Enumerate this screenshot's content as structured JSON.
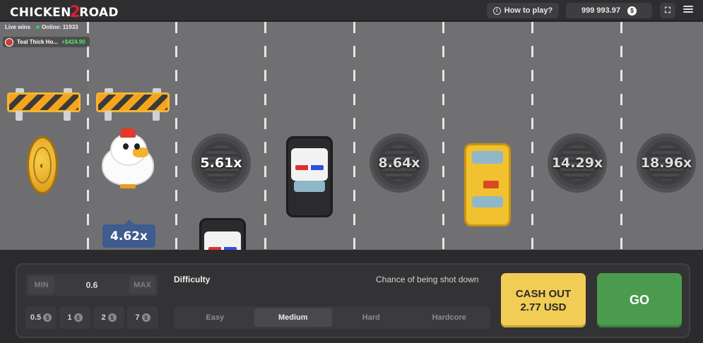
{
  "header": {
    "logo_left": "CHICKEN",
    "logo_mid": "2",
    "logo_right": "ROAD",
    "how_to_play": "How to play?",
    "balance": "999 993.97",
    "currency_symbol": "$"
  },
  "live": {
    "label": "Live wins",
    "online": "Online: 11933",
    "winner_name": "Teal Thick Ho...",
    "winner_amount": "+$424.90"
  },
  "board": {
    "chicken_multiplier": "4.62x",
    "lanes": [
      "5.61x",
      "8.64x",
      "14.29x",
      "18.96x"
    ]
  },
  "controls": {
    "min_label": "MIN",
    "max_label": "MAX",
    "bet_value": "0.6",
    "chips": [
      "0.5",
      "1",
      "2",
      "7"
    ],
    "difficulty_label": "Difficulty",
    "chance_label": "Chance of being shot down",
    "difficulties": [
      "Easy",
      "Medium",
      "Hard",
      "Hardcore"
    ],
    "active_difficulty": "Medium",
    "cashout_line1": "CASH OUT",
    "cashout_line2": "2.77 USD",
    "go_label": "GO"
  },
  "colors": {
    "road": "#707072",
    "cashout": "#f1cd55",
    "go": "#4b9b4f",
    "multiplier_tag": "#3f5b8f",
    "win_green": "#4ee86a"
  }
}
